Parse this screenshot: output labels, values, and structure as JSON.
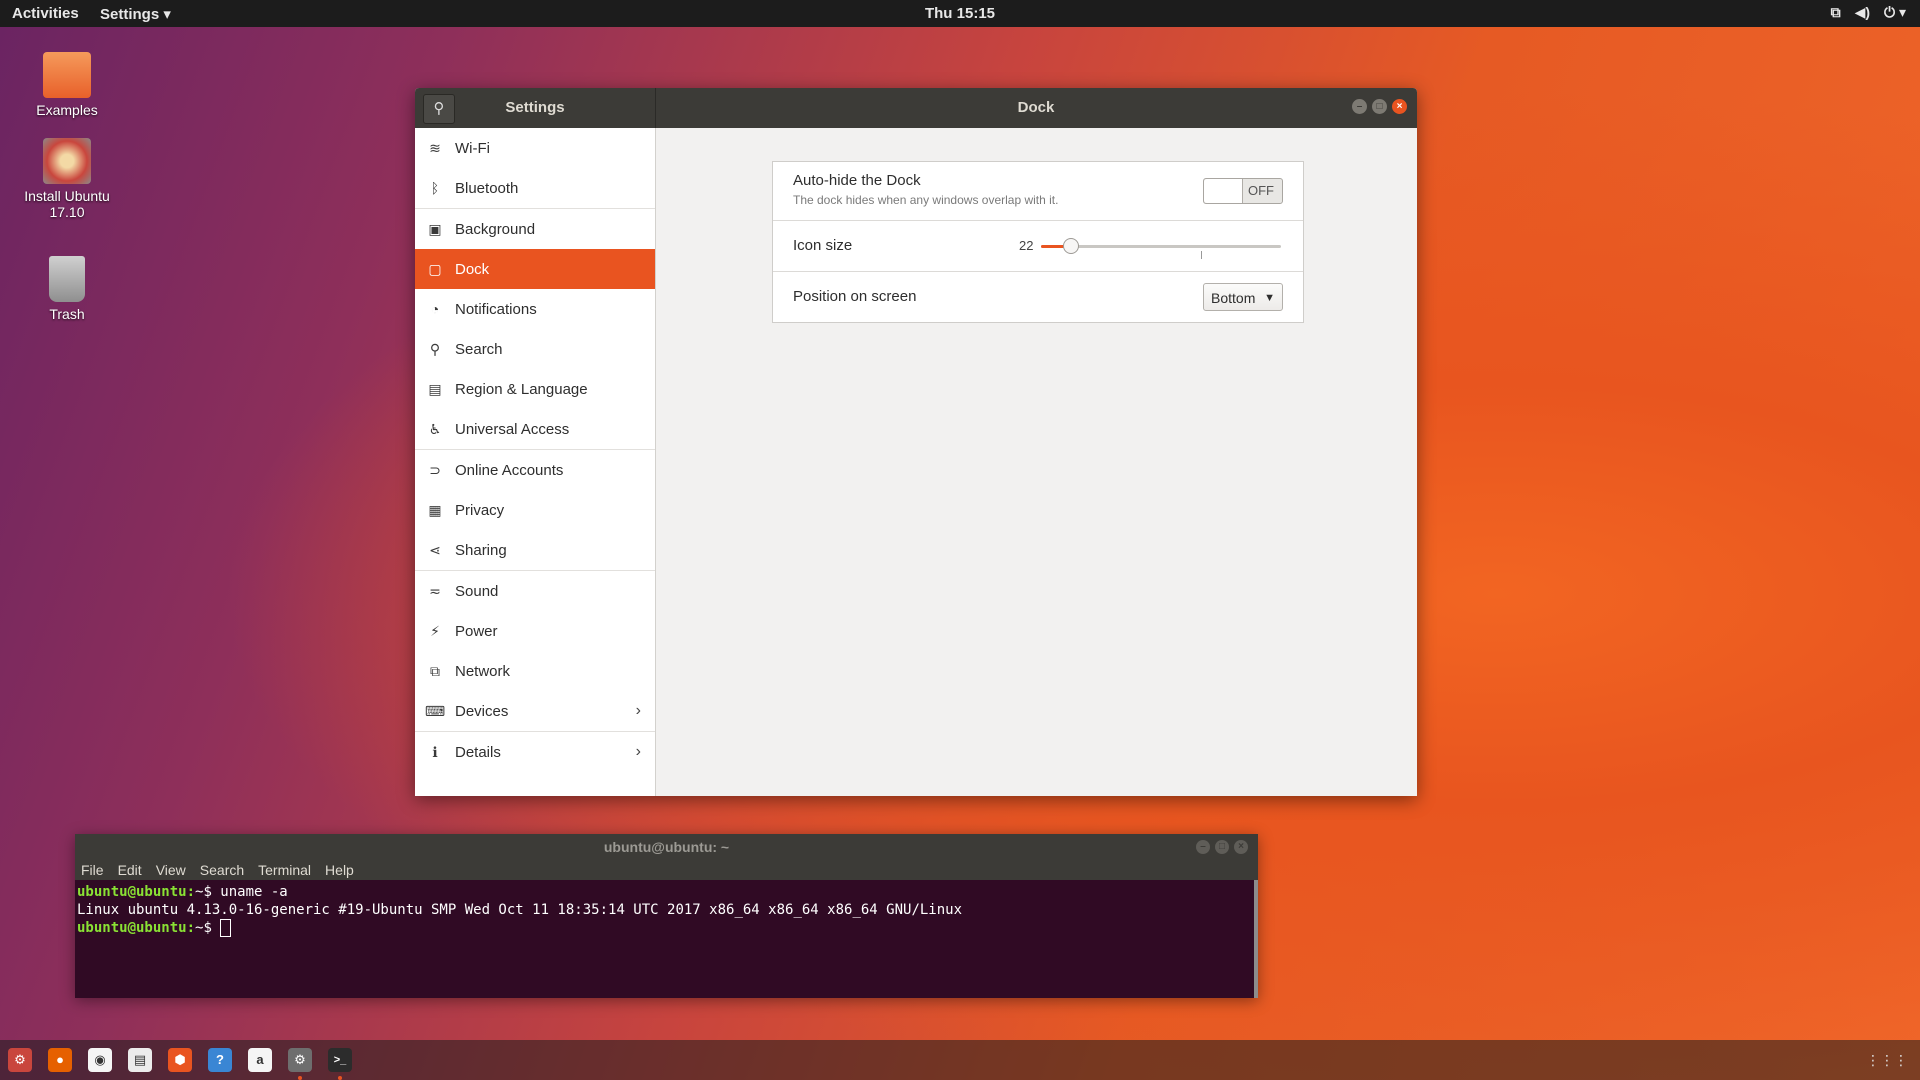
{
  "topbar": {
    "activities": "Activities",
    "app_menu": "Settings ▾",
    "clock": "Thu 15:15",
    "tray_icons": [
      "network-icon",
      "volume-icon",
      "power-icon"
    ]
  },
  "desktop_icons": [
    {
      "label": "Examples",
      "icon": "folder-icon",
      "color": "#f07a3e"
    },
    {
      "label": "Install Ubuntu 17.10",
      "icon": "installer-icon",
      "color": "#d9534f"
    },
    {
      "label": "Trash",
      "icon": "trash-icon",
      "color": "#9a9a9a"
    }
  ],
  "settings": {
    "search_icon": "🔍",
    "left_title": "Settings",
    "main_title": "Dock",
    "sidebar": [
      {
        "label": "Wi-Fi",
        "icon": "≋"
      },
      {
        "label": "Bluetooth",
        "icon": "ᛒ"
      },
      {
        "label": "Background",
        "icon": "▣"
      },
      {
        "label": "Dock",
        "icon": "▢"
      },
      {
        "label": "Notifications",
        "icon": "◔"
      },
      {
        "label": "Search",
        "icon": "⚲"
      },
      {
        "label": "Region & Language",
        "icon": "▤"
      },
      {
        "label": "Universal Access",
        "icon": "♿"
      },
      {
        "label": "Online Accounts",
        "icon": "⊃"
      },
      {
        "label": "Privacy",
        "icon": "▦"
      },
      {
        "label": "Sharing",
        "icon": "⋖"
      },
      {
        "label": "Sound",
        "icon": "≂"
      },
      {
        "label": "Power",
        "icon": "⚡"
      },
      {
        "label": "Network",
        "icon": "⧉"
      },
      {
        "label": "Devices",
        "icon": "⌨",
        "chevron": "›"
      },
      {
        "label": "Details",
        "icon": "ℹ",
        "chevron": "›"
      }
    ],
    "dock": {
      "autohide_label": "Auto-hide the Dock",
      "autohide_desc": "The dock hides when any windows overlap with it.",
      "autohide_state": "OFF",
      "icon_size_label": "Icon size",
      "icon_size_value": "22",
      "icon_size_fraction": 0.12,
      "position_label": "Position on screen",
      "position_value": "Bottom"
    }
  },
  "terminal": {
    "title": "ubuntu@ubuntu: ~",
    "menu": [
      "File",
      "Edit",
      "View",
      "Search",
      "Terminal",
      "Help"
    ],
    "line1_prompt": "ubuntu@ubuntu:",
    "line1_rest": "~$ uname -a",
    "line2": "Linux ubuntu 4.13.0-16-generic #19-Ubuntu SMP Wed Oct 11 18:35:14 UTC 2017 x86_64 x86_64 x86_64 GNU/Linux",
    "line3_prompt": "ubuntu@ubuntu:",
    "line3_rest": "~$ "
  },
  "dock": {
    "apps": [
      {
        "name": "installer-icon",
        "glyph": "⚙",
        "color": "#c9463d"
      },
      {
        "name": "firefox-icon",
        "glyph": "●",
        "color": "#e66000"
      },
      {
        "name": "rhythmbox-icon",
        "glyph": "◉",
        "color": "#f5f5f5"
      },
      {
        "name": "files-icon",
        "glyph": "▤",
        "color": "#ececec"
      },
      {
        "name": "software-icon",
        "glyph": "⬢",
        "color": "#e95420"
      },
      {
        "name": "help-icon",
        "glyph": "?",
        "color": "#3a86d4"
      },
      {
        "name": "amazon-icon",
        "glyph": "a",
        "color": "#f5f5f5"
      },
      {
        "name": "settings-icon",
        "glyph": "⚙",
        "color": "#6e6e6e"
      },
      {
        "name": "terminal-icon",
        "glyph": ">_",
        "color": "#2c2c2c"
      }
    ],
    "show_apps": "⋮⋮⋮"
  }
}
